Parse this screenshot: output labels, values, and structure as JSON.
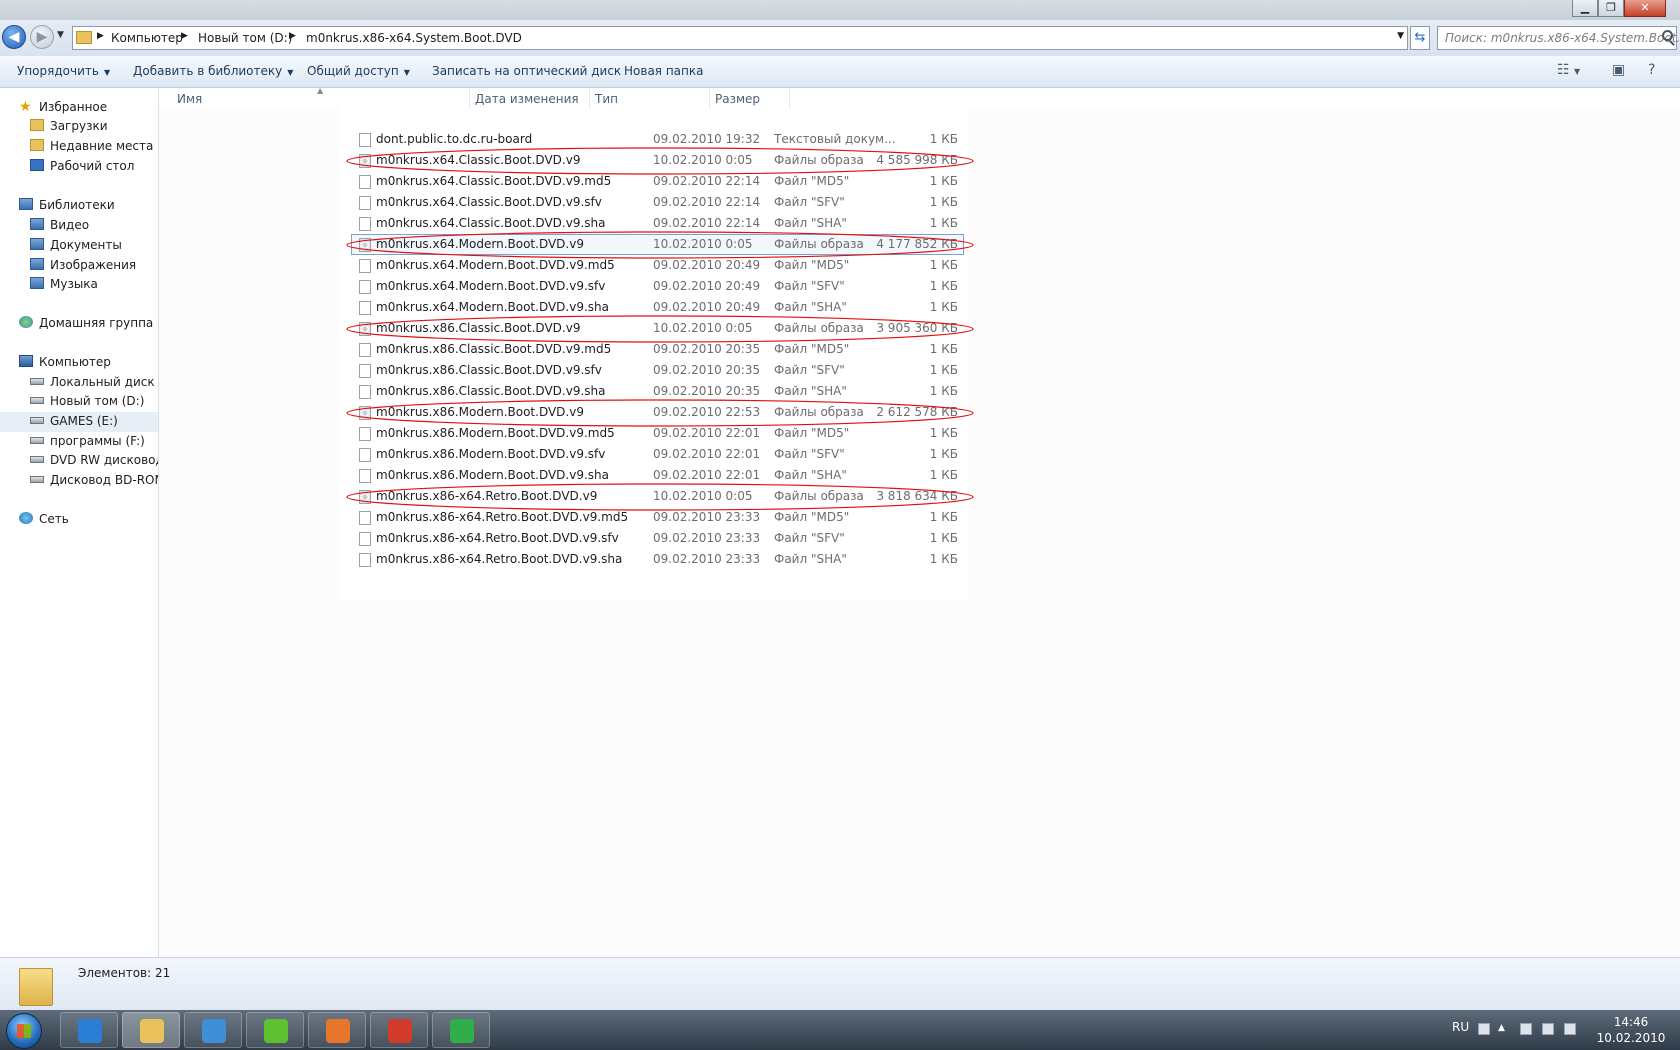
{
  "address": {
    "crumbs": [
      "Компьютер",
      "Новый том (D:)",
      "m0nkrus.x86-x64.System.Boot.DVD"
    ],
    "search_placeholder": "Поиск: m0nkrus.x86-x64.System.Boot...."
  },
  "toolbar": {
    "organize": "Упорядочить",
    "add_to_library": "Добавить в библиотеку",
    "share": "Общий доступ",
    "burn": "Записать на оптический диск",
    "new_folder": "Новая папка"
  },
  "nav": {
    "favorites": "Избранное",
    "downloads": "Загрузки",
    "recent": "Недавние места",
    "desktop": "Рабочий стол",
    "libraries": "Библиотеки",
    "video": "Видео",
    "documents": "Документы",
    "pictures": "Изображения",
    "music": "Музыка",
    "homegroup": "Домашняя группа",
    "computer": "Компьютер",
    "drive_c": "Локальный диск (C",
    "drive_d": "Новый том (D:)",
    "drive_e": "GAMES (E:)",
    "drive_f": "программы (F:)",
    "dvd_rw": "DVD RW дисковод (",
    "bd_rom": "Дисковод BD-ROM",
    "network": "Сеть"
  },
  "columns": {
    "name": "Имя",
    "date": "Дата изменения",
    "type": "Тип",
    "size": "Размер"
  },
  "files": [
    {
      "name": "dont.public.to.dc.ru-board",
      "date": "09.02.2010 19:32",
      "type": "Текстовый докум...",
      "size": "1 КБ",
      "iso": false,
      "circled": false
    },
    {
      "name": "m0nkrus.x64.Classic.Boot.DVD.v9",
      "date": "10.02.2010 0:05",
      "type": "Файлы образа",
      "size": "4 585 998 КБ",
      "iso": true,
      "circled": true
    },
    {
      "name": "m0nkrus.x64.Classic.Boot.DVD.v9.md5",
      "date": "09.02.2010 22:14",
      "type": "Файл \"MD5\"",
      "size": "1 КБ",
      "iso": false,
      "circled": false
    },
    {
      "name": "m0nkrus.x64.Classic.Boot.DVD.v9.sfv",
      "date": "09.02.2010 22:14",
      "type": "Файл \"SFV\"",
      "size": "1 КБ",
      "iso": false,
      "circled": false
    },
    {
      "name": "m0nkrus.x64.Classic.Boot.DVD.v9.sha",
      "date": "09.02.2010 22:14",
      "type": "Файл \"SHA\"",
      "size": "1 КБ",
      "iso": false,
      "circled": false
    },
    {
      "name": "m0nkrus.x64.Modern.Boot.DVD.v9",
      "date": "10.02.2010 0:05",
      "type": "Файлы образа",
      "size": "4 177 852 КБ",
      "iso": true,
      "circled": true,
      "selected": true
    },
    {
      "name": "m0nkrus.x64.Modern.Boot.DVD.v9.md5",
      "date": "09.02.2010 20:49",
      "type": "Файл \"MD5\"",
      "size": "1 КБ",
      "iso": false,
      "circled": false
    },
    {
      "name": "m0nkrus.x64.Modern.Boot.DVD.v9.sfv",
      "date": "09.02.2010 20:49",
      "type": "Файл \"SFV\"",
      "size": "1 КБ",
      "iso": false,
      "circled": false
    },
    {
      "name": "m0nkrus.x64.Modern.Boot.DVD.v9.sha",
      "date": "09.02.2010 20:49",
      "type": "Файл \"SHA\"",
      "size": "1 КБ",
      "iso": false,
      "circled": false
    },
    {
      "name": "m0nkrus.x86.Classic.Boot.DVD.v9",
      "date": "10.02.2010 0:05",
      "type": "Файлы образа",
      "size": "3 905 360 КБ",
      "iso": true,
      "circled": true
    },
    {
      "name": "m0nkrus.x86.Classic.Boot.DVD.v9.md5",
      "date": "09.02.2010 20:35",
      "type": "Файл \"MD5\"",
      "size": "1 КБ",
      "iso": false,
      "circled": false
    },
    {
      "name": "m0nkrus.x86.Classic.Boot.DVD.v9.sfv",
      "date": "09.02.2010 20:35",
      "type": "Файл \"SFV\"",
      "size": "1 КБ",
      "iso": false,
      "circled": false
    },
    {
      "name": "m0nkrus.x86.Classic.Boot.DVD.v9.sha",
      "date": "09.02.2010 20:35",
      "type": "Файл \"SHA\"",
      "size": "1 КБ",
      "iso": false,
      "circled": false
    },
    {
      "name": "m0nkrus.x86.Modern.Boot.DVD.v9",
      "date": "09.02.2010 22:53",
      "type": "Файлы образа",
      "size": "2 612 578 КБ",
      "iso": true,
      "circled": true
    },
    {
      "name": "m0nkrus.x86.Modern.Boot.DVD.v9.md5",
      "date": "09.02.2010 22:01",
      "type": "Файл \"MD5\"",
      "size": "1 КБ",
      "iso": false,
      "circled": false
    },
    {
      "name": "m0nkrus.x86.Modern.Boot.DVD.v9.sfv",
      "date": "09.02.2010 22:01",
      "type": "Файл \"SFV\"",
      "size": "1 КБ",
      "iso": false,
      "circled": false
    },
    {
      "name": "m0nkrus.x86.Modern.Boot.DVD.v9.sha",
      "date": "09.02.2010 22:01",
      "type": "Файл \"SHA\"",
      "size": "1 КБ",
      "iso": false,
      "circled": false
    },
    {
      "name": "m0nkrus.x86-x64.Retro.Boot.DVD.v9",
      "date": "10.02.2010 0:05",
      "type": "Файлы образа",
      "size": "3 818 634 КБ",
      "iso": true,
      "circled": true
    },
    {
      "name": "m0nkrus.x86-x64.Retro.Boot.DVD.v9.md5",
      "date": "09.02.2010 23:33",
      "type": "Файл \"MD5\"",
      "size": "1 КБ",
      "iso": false,
      "circled": false
    },
    {
      "name": "m0nkrus.x86-x64.Retro.Boot.DVD.v9.sfv",
      "date": "09.02.2010 23:33",
      "type": "Файл \"SFV\"",
      "size": "1 КБ",
      "iso": false,
      "circled": false
    },
    {
      "name": "m0nkrus.x86-x64.Retro.Boot.DVD.v9.sha",
      "date": "09.02.2010 23:33",
      "type": "Файл \"SHA\"",
      "size": "1 КБ",
      "iso": false,
      "circled": false
    }
  ],
  "details": {
    "item_count": "Элементов: 21"
  },
  "taskbar": {
    "lang": "RU",
    "time": "14:46",
    "date": "10.02.2010",
    "apps": [
      {
        "icon": "internet-explorer-icon",
        "color": "#2a7fd4"
      },
      {
        "icon": "windows-explorer-icon",
        "color": "#e8c25b"
      },
      {
        "icon": "media-player-icon",
        "color": "#3f8fd8"
      },
      {
        "icon": "icq-icon",
        "color": "#5cc12f"
      },
      {
        "icon": "firefox-icon",
        "color": "#e8762a"
      },
      {
        "icon": "red-app-icon",
        "color": "#d23a2a"
      },
      {
        "icon": "utorrent-icon",
        "color": "#2fae4a"
      }
    ]
  },
  "colors": {
    "markup_ellipse": "#e01010",
    "selection": "#7da2ce"
  }
}
